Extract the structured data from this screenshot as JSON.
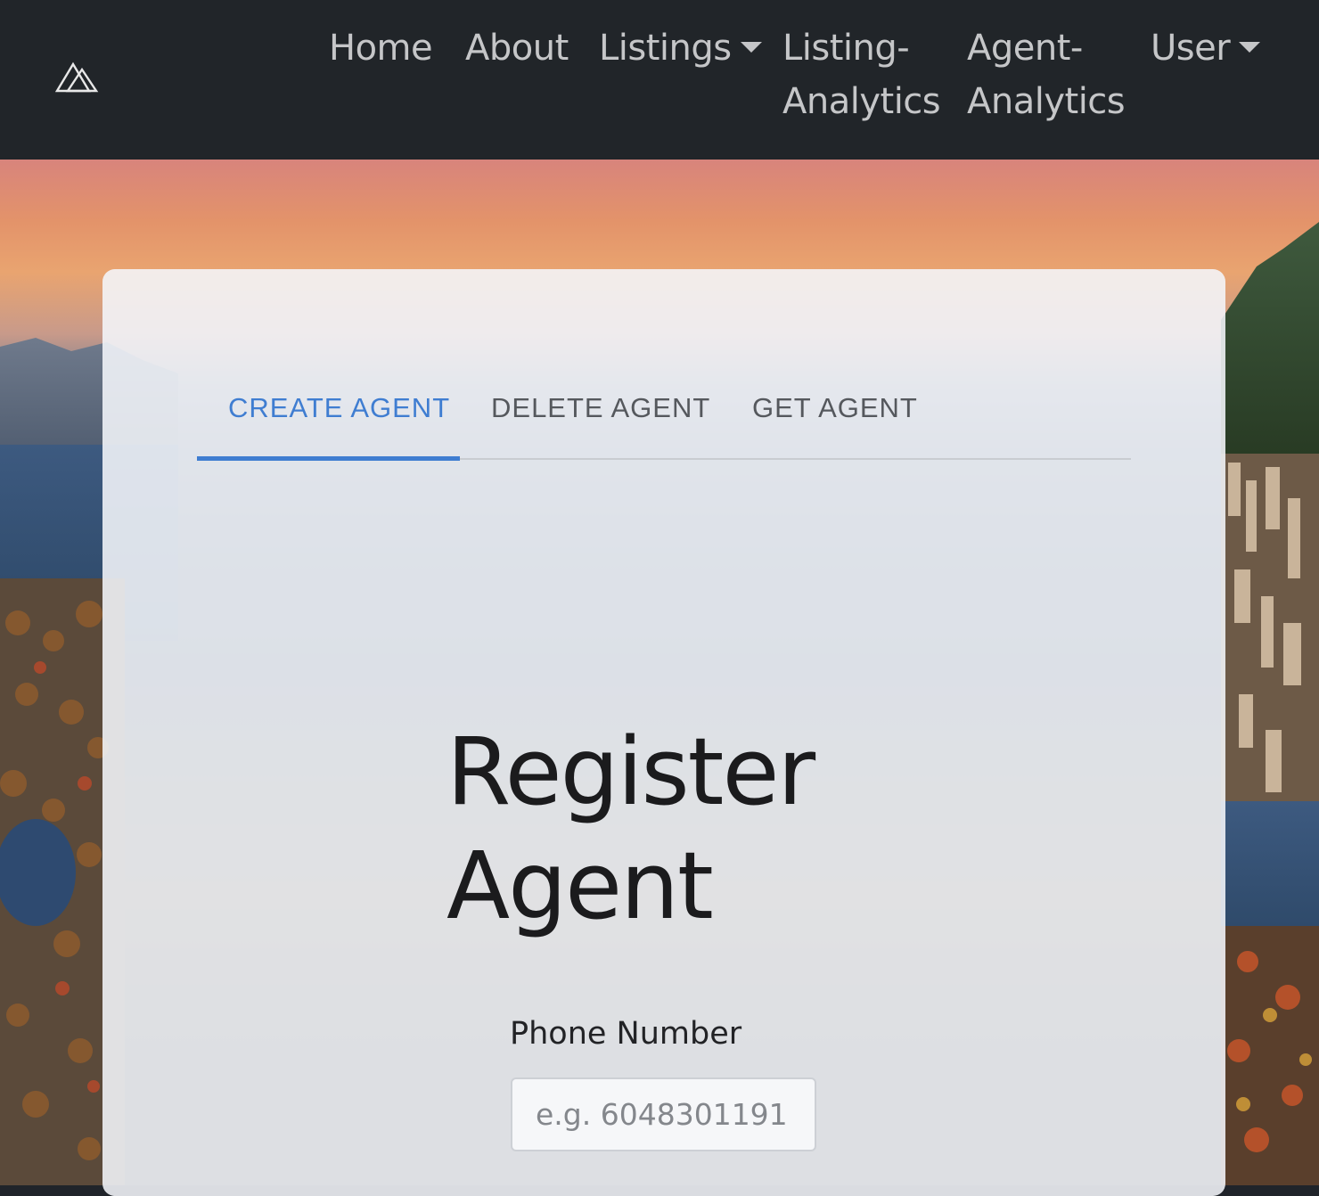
{
  "navbar": {
    "logo_icon": "mountain-logo-icon",
    "items": [
      {
        "label": "Home"
      },
      {
        "label": "About"
      },
      {
        "label": "Listings",
        "dropdown": true
      },
      {
        "label_line1": "Listing-",
        "label_line2": "Analytics"
      },
      {
        "label_line1": "Agent-",
        "label_line2": "Analytics"
      },
      {
        "label": "User",
        "dropdown": true
      }
    ]
  },
  "tabs": [
    {
      "label": "CREATE AGENT",
      "active": true
    },
    {
      "label": "DELETE AGENT",
      "active": false
    },
    {
      "label": "GET AGENT",
      "active": false
    }
  ],
  "form": {
    "title_line1": "Register",
    "title_line2": "Agent",
    "phone_label": "Phone Number",
    "phone_placeholder": "e.g. 6048301191",
    "phone_value": ""
  },
  "colors": {
    "navbar_bg": "#212529",
    "nav_text": "#c5c6c8",
    "active_tab": "#3f7dd1",
    "card_bg": "#f4f6fa"
  }
}
